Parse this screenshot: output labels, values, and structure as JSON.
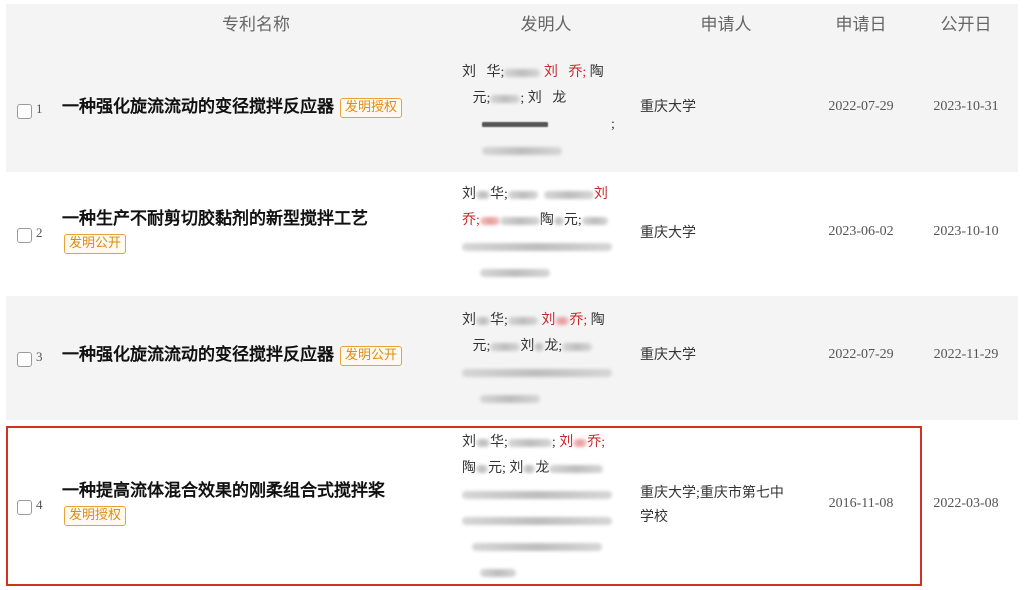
{
  "columns": {
    "name": "专利名称",
    "inventor": "发明人",
    "applicant": "申请人",
    "apply_date": "申请日",
    "publish_date": "公开日"
  },
  "rows": [
    {
      "index": "1",
      "title": "一种强化旋流流动的变径搅拌反应器",
      "badge": "发明授权",
      "inv": {
        "a": "刘",
        "b": "华;",
        "c": "刘",
        "d": "乔;",
        "e": "陶",
        "f": "元;",
        "g": "; 刘",
        "h": "龙",
        "i": ";"
      },
      "applicant": "重庆大学",
      "apply_date": "2022-07-29",
      "publish_date": "2023-10-31"
    },
    {
      "index": "2",
      "title": "一种生产不耐剪切胶黏剂的新型搅拌工艺",
      "badge": "发明公开",
      "inv": {
        "a": "刘",
        "b": "华;",
        "c": "刘",
        "d": "乔;",
        "e": "陶",
        "f": "元;"
      },
      "applicant": "重庆大学",
      "apply_date": "2023-06-02",
      "publish_date": "2023-10-10"
    },
    {
      "index": "3",
      "title": "一种强化旋流流动的变径搅拌反应器",
      "badge": "发明公开",
      "inv": {
        "a": "刘",
        "b": "华;",
        "c": "刘",
        "d": "乔;",
        "e": "陶",
        "f": "元;",
        "g": "刘",
        "h": "龙;"
      },
      "applicant": "重庆大学",
      "apply_date": "2022-07-29",
      "publish_date": "2022-11-29"
    },
    {
      "index": "4",
      "title": "一种提高流体混合效果的刚柔组合式搅拌桨",
      "badge": "发明授权",
      "inv": {
        "a": "刘",
        "b": "华;",
        "c": "刘",
        "d": "乔;",
        "e": "陶",
        "f": "元;",
        "g": "刘",
        "h": "龙"
      },
      "applicant_line1": "重庆大学;重庆市第七中",
      "applicant_line2": "学校",
      "apply_date": "2016-11-08",
      "publish_date": "2022-03-08"
    }
  ],
  "colors": {
    "badge": "#e08a12",
    "highlight_border": "#d0341f",
    "red_name": "#c62828"
  }
}
